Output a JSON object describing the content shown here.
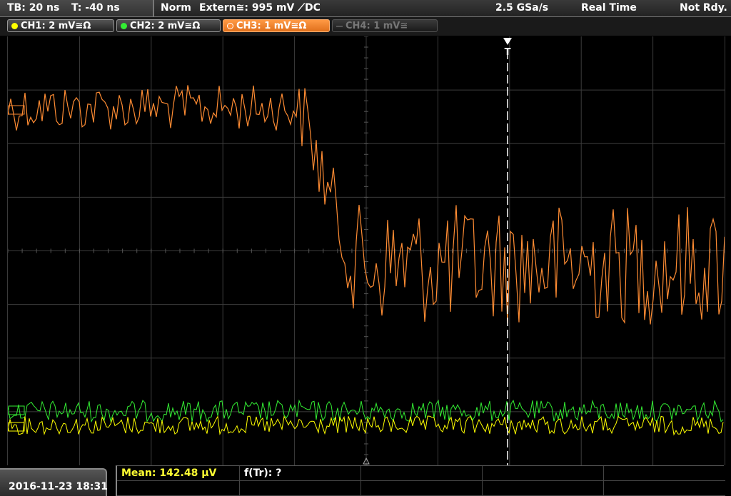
{
  "topbar": {
    "timebase": "TB: 20 ns",
    "trigger_time": "T: -40 ns",
    "mode": "Norm",
    "trigger_source": "Extern≅: 995 mV ⟋DC",
    "sample_rate": "2.5 GSa/s",
    "acq_mode": "Real Time",
    "status": "Not Rdy."
  },
  "channels": [
    {
      "label": "CH1: 2 mV≅Ω",
      "color": "#ffff00",
      "active": false
    },
    {
      "label": "CH2: 2 mV≅Ω",
      "color": "#33ee33",
      "active": false
    },
    {
      "label": "CH3: 1 mV≅Ω",
      "color": "#ff8c33",
      "active": true
    },
    {
      "label": "CH4: 1 mV≅",
      "color": "#777777",
      "active": false
    }
  ],
  "trigger_marker_label": "T",
  "bottom": {
    "datetime": "2016-11-23 18:31",
    "measure_mean": "Mean: 142.48 µV",
    "measure_ftr": "f(Tr): ?"
  },
  "colors": {
    "ch1": "#ffff00",
    "ch2": "#33ee33",
    "ch3": "#ff8c33",
    "grid": "#3c3c3c",
    "background": "#000000"
  }
}
